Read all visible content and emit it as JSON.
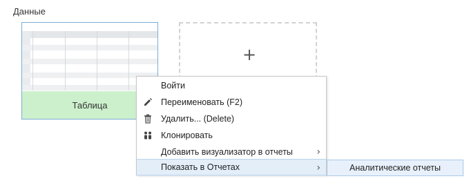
{
  "section": {
    "title": "Данные"
  },
  "card": {
    "label": "Таблица"
  },
  "add_card": {
    "icon": "plus-icon",
    "glyph": "+"
  },
  "context_menu": {
    "items": [
      {
        "label": "Войти",
        "icon": ""
      },
      {
        "label": "Переименовать (F2)",
        "icon": "pencil-icon"
      },
      {
        "label": "Удалить... (Delete)",
        "icon": "trash-icon"
      },
      {
        "label": "Клонировать",
        "icon": "clone-icon"
      },
      {
        "label": "Добавить визуализатор в отчеты",
        "icon": "",
        "has_submenu": true,
        "arrow": "›"
      },
      {
        "label": "Показать в Отчетах",
        "icon": "",
        "has_submenu": true,
        "arrow": "›",
        "active": true
      }
    ]
  },
  "submenu": {
    "items": [
      {
        "label": "Аналитические отчеты"
      }
    ]
  },
  "colors": {
    "card_border": "#7aaed6",
    "card_footer": "#ccf0cc",
    "menu_active": "#e3eef9",
    "submenu_bg": "#e8f1fb"
  }
}
